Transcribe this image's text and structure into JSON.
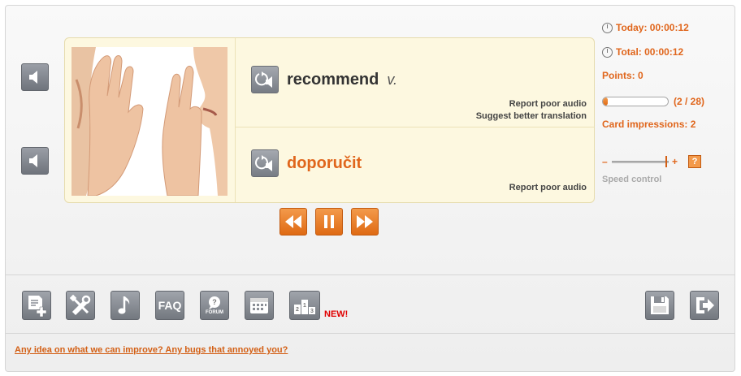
{
  "card": {
    "term": "recommend",
    "part_of_speech": "v.",
    "translation": "doporučit",
    "report_audio_top": "Report poor audio",
    "suggest_translation": "Suggest better translation",
    "report_audio_bottom": "Report poor audio"
  },
  "stats": {
    "today": "Today: 00:00:12",
    "total": "Total: 00:00:12",
    "points": "Points: 0",
    "progress_text": "(2 / 28)",
    "progress_fraction": 0.07,
    "card_impressions": "Card impressions: 2",
    "speed_minus": "–",
    "speed_plus": "+",
    "speed_help": "?",
    "speed_label": "Speed control"
  },
  "toolbar": {
    "faq_label": "FAQ",
    "forum_label": "FORUM",
    "new_badge": "NEW!"
  },
  "footer": {
    "feedback_link": "Any idea on what we can improve? Any bugs that annoyed you?"
  },
  "colors": {
    "accent": "#e0661c",
    "card_bg": "#fdf8e0",
    "button_gray": "#878b92",
    "new_red": "#e00000"
  },
  "icons": {
    "side_buttons": "speaker-icon",
    "audio_buttons": "replay-audio-icon",
    "player": [
      "rewind-icon",
      "pause-icon",
      "fast-forward-icon"
    ],
    "tools": [
      "add-card-icon",
      "settings-tools-icon",
      "music-note-icon",
      "faq-icon",
      "forum-icon",
      "calendar-icon",
      "leaderboard-icon",
      "save-icon",
      "exit-icon"
    ]
  }
}
